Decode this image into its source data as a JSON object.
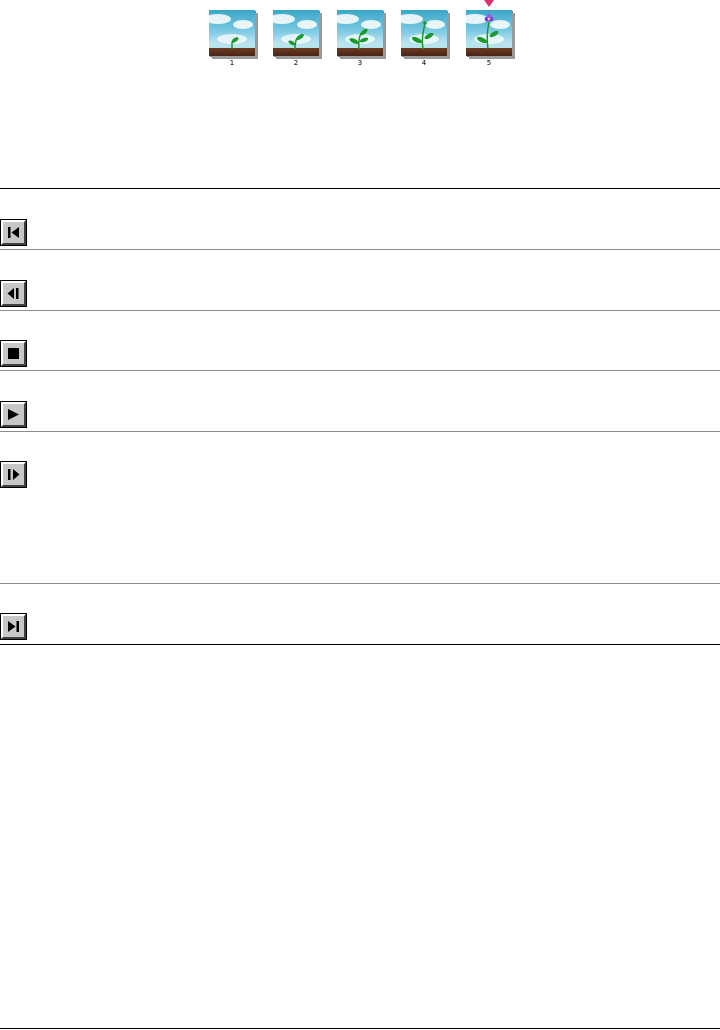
{
  "frames": [
    {
      "number": "1"
    },
    {
      "number": "2"
    },
    {
      "number": "3"
    },
    {
      "number": "4"
    },
    {
      "number": "5"
    }
  ],
  "current_frame": 5,
  "controls": [
    {
      "icon": "go-to-first-frame-icon"
    },
    {
      "icon": "step-backward-icon"
    },
    {
      "icon": "stop-icon"
    },
    {
      "icon": "play-icon"
    },
    {
      "icon": "step-forward-icon"
    },
    {
      "icon": "go-to-last-frame-icon"
    }
  ],
  "colors": {
    "sky": "#3ba6c9",
    "soil": "#4a2414",
    "leaf": "#1a9a2a",
    "flower": "#7b3fd6",
    "marker": "#e0306a"
  }
}
